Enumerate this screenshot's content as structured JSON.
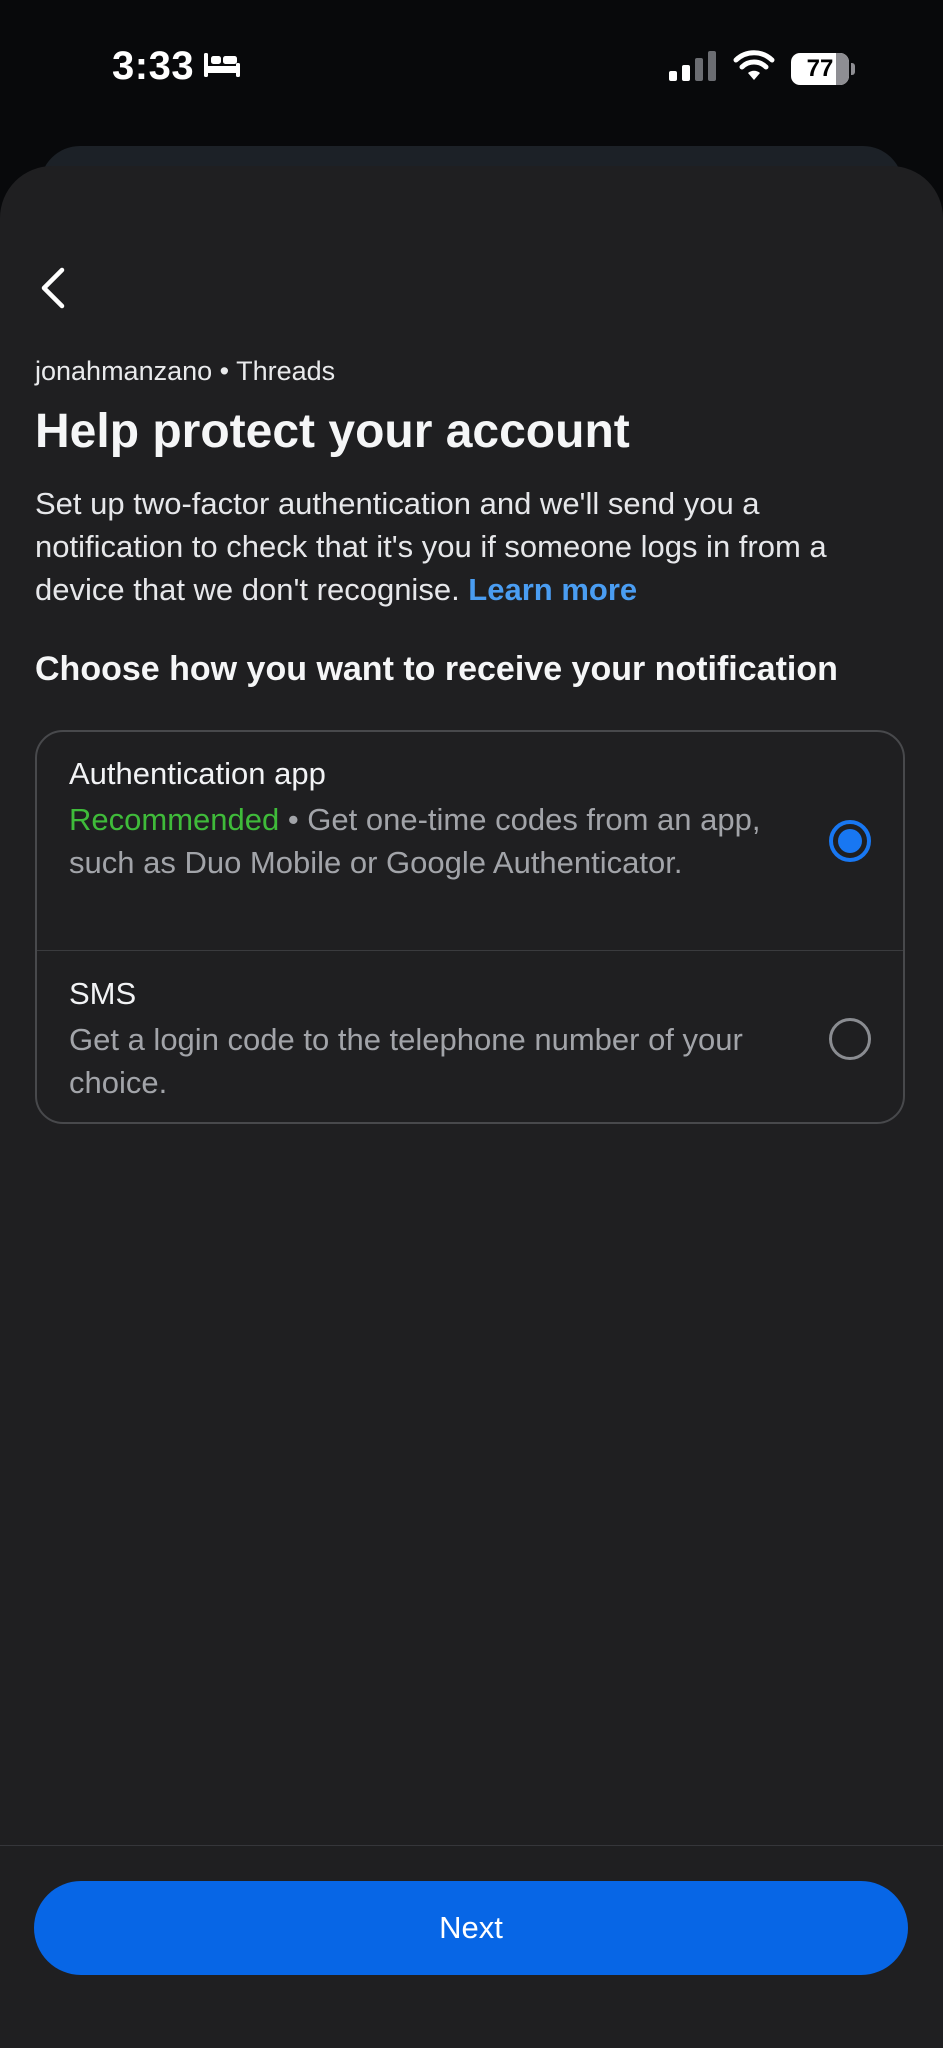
{
  "status_bar": {
    "time": "3:33",
    "sleep_icon": "bed-icon",
    "signal_icon": "cellular-signal-icon",
    "wifi_icon": "wifi-icon",
    "battery_level": "77",
    "battery_fraction": 0.77
  },
  "header": {
    "back_icon": "chevron-left-icon",
    "subtitle": "jonahmanzano • Threads",
    "title": "Help protect your account"
  },
  "description": {
    "text": "Set up two-factor authentication and we'll send you a notification to check that it's you if someone logs in from a device that we don't recognise. ",
    "learn_more": "Learn more"
  },
  "section_heading": "Choose how you want to receive your notification",
  "options": [
    {
      "title": "Authentication app",
      "badge": "Recommended",
      "description": " • Get one-time codes from an app, such as Duo Mobile or Google Authenticator.",
      "selected": true
    },
    {
      "title": "SMS",
      "description": "Get a login code to the telephone number of your choice.",
      "selected": false
    }
  ],
  "footer": {
    "next_label": "Next"
  },
  "colors": {
    "background": "#1f1f21",
    "accent_blue": "#0766e6",
    "link_blue": "#4a9df2",
    "recommended_green": "#3fbb3a"
  }
}
